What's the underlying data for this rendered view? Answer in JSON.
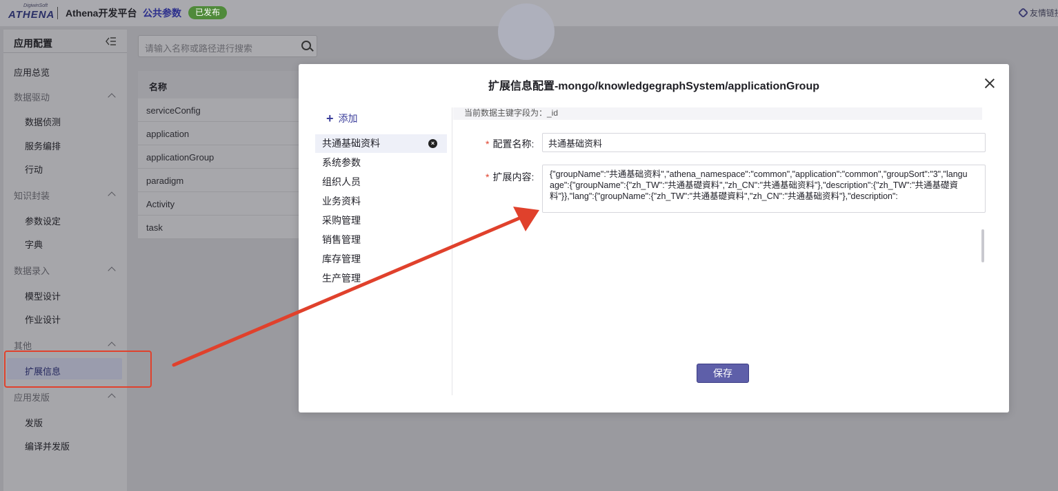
{
  "header": {
    "logo_small": "DigiwinSoft",
    "logo_big": "ATHENA",
    "platform_title": "Athena开发平台",
    "section_title": "公共参数",
    "status_badge": "已发布",
    "friend_link": "友情链接"
  },
  "sidebar": {
    "title": "应用配置",
    "overview": "应用总览",
    "groups": [
      {
        "label": "数据驱动",
        "items": [
          "数据侦测",
          "服务编排",
          "行动"
        ]
      },
      {
        "label": "知识封装",
        "items": [
          "参数设定",
          "字典"
        ]
      },
      {
        "label": "数据录入",
        "items": [
          "模型设计",
          "作业设计"
        ]
      },
      {
        "label": "其他",
        "items": [
          "扩展信息"
        ]
      },
      {
        "label": "应用发版",
        "items": [
          "发版",
          "编译并发版"
        ]
      }
    ],
    "active_item": "扩展信息"
  },
  "search": {
    "placeholder": "请输入名称或路径进行搜索"
  },
  "table": {
    "header": "名称",
    "rows": [
      "serviceConfig",
      "application",
      "applicationGroup",
      "paradigm",
      "Activity",
      "task"
    ]
  },
  "modal": {
    "title": "扩展信息配置-mongo/knowledgegraphSystem/applicationGroup",
    "add_label": "添加",
    "groups": [
      "共通基础资料",
      "系统参数",
      "组织人员",
      "业务资料",
      "采购管理",
      "销售管理",
      "库存管理",
      "生产管理"
    ],
    "active_group": "共通基础资料",
    "pk_info": "当前数据主键字段为：_id",
    "config_name_label": "配置名称:",
    "config_name_value": "共通基础资料",
    "ext_content_label": "扩展内容:",
    "ext_content_value": "{\"groupName\":\"共通基础资料\",\"athena_namespace\":\"common\",\"application\":\"common\",\"groupSort\":\"3\",\"language\":{\"groupName\":{\"zh_TW\":\"共通基礎資料\",\"zh_CN\":\"共通基础资料\"},\"description\":{\"zh_TW\":\"共通基礎資料\"}},\"lang\":{\"groupName\":{\"zh_TW\":\"共通基礎資料\",\"zh_CN\":\"共通基础资料\"},\"description\":",
    "save_label": "保存"
  },
  "colors": {
    "accent": "#5e5fa9",
    "badge_green": "#4f8a3a",
    "annotation_red": "#e0412c"
  }
}
